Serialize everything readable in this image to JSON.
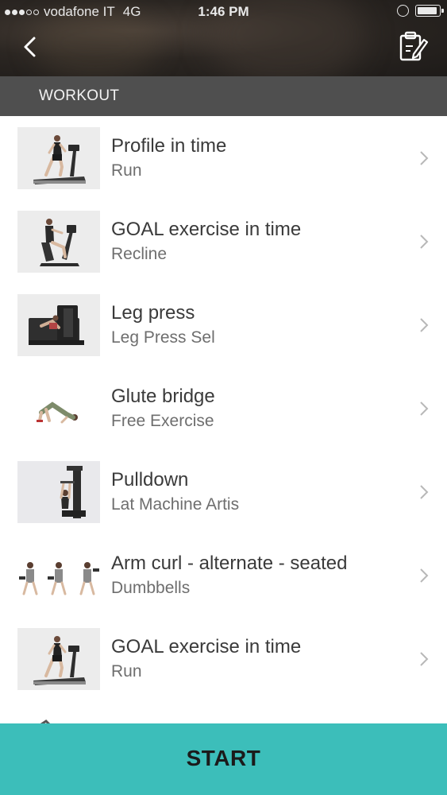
{
  "status_bar": {
    "carrier": "vodafone IT",
    "network": "4G",
    "time": "1:46 PM"
  },
  "header": {
    "back_icon": "chevron-left-icon",
    "clipboard_icon": "clipboard-edit-icon"
  },
  "section": {
    "title": "WORKOUT"
  },
  "exercises": [
    {
      "title": "Profile in time",
      "subtitle": "Run",
      "thumb": "treadmill"
    },
    {
      "title": "GOAL exercise in time",
      "subtitle": "Recline",
      "thumb": "recumbent-bike"
    },
    {
      "title": "Leg press",
      "subtitle": "Leg Press Sel",
      "thumb": "leg-press-machine"
    },
    {
      "title": "Glute bridge",
      "subtitle": "Free Exercise",
      "thumb": "glute-bridge"
    },
    {
      "title": "Pulldown",
      "subtitle": "Lat Machine Artis",
      "thumb": "lat-machine"
    },
    {
      "title": "Arm curl - alternate - seated",
      "subtitle": "Dumbbells",
      "thumb": "dumbbell-curl"
    },
    {
      "title": "GOAL exercise in time",
      "subtitle": "Run",
      "thumb": "treadmill"
    }
  ],
  "footer": {
    "start_label": "START"
  },
  "colors": {
    "accent": "#3cbeba",
    "section_bar": "#4f4f4f"
  }
}
